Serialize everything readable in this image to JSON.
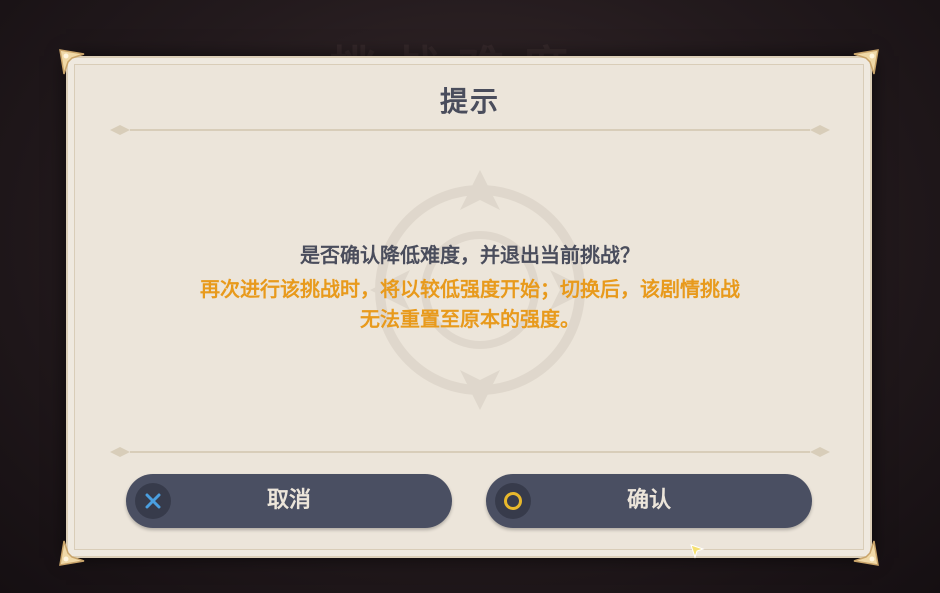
{
  "background": {
    "title_fragment": "挑战难度"
  },
  "dialog": {
    "title": "提示",
    "message": "是否确认降低难度，并退出当前挑战？",
    "warning_line1": "再次进行该挑战时，将以较低强度开始；切换后，该剧情挑战",
    "warning_line2": "无法重置至原本的强度。"
  },
  "buttons": {
    "cancel": {
      "label": "取消",
      "icon": "cross-icon"
    },
    "confirm": {
      "label": "确认",
      "icon": "circle-icon"
    }
  },
  "colors": {
    "panel": "#ece5da",
    "text": "#4a4d5c",
    "warning": "#e89a1c",
    "button": "#4a4f62",
    "cross": "#4a9fe0",
    "circle": "#e8b82c"
  }
}
